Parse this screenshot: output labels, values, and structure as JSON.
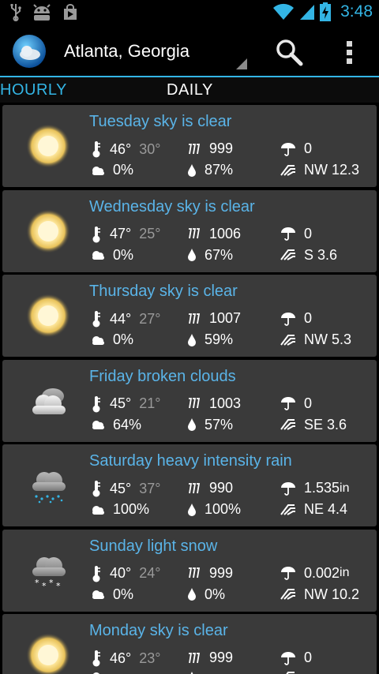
{
  "status_bar": {
    "time": "3:48",
    "icons": [
      "usb-icon",
      "android-debug-icon",
      "play-store-icon",
      "wifi-icon",
      "signal-icon",
      "battery-charging-icon"
    ]
  },
  "action_bar": {
    "location": "Atlanta, Georgia",
    "icons": [
      "app-globe-icon",
      "search-icon",
      "overflow-menu-icon"
    ]
  },
  "tabs": {
    "hourly": "HOURLY",
    "daily": "DAILY",
    "selected": "DAILY"
  },
  "colors": {
    "accent": "#33b5e5",
    "title": "#5ab4e8",
    "card": "#3a3a3a"
  },
  "days": [
    {
      "title": "Tuesday sky is clear",
      "icon": "sun",
      "hi": "46°",
      "lo": "30°",
      "pressure": "999",
      "precip": "0",
      "precip_unit": "",
      "clouds": "0%",
      "humidity": "87%",
      "wind": "NW 12.3"
    },
    {
      "title": "Wednesday sky is clear",
      "icon": "sun",
      "hi": "47°",
      "lo": "25°",
      "pressure": "1006",
      "precip": "0",
      "precip_unit": "",
      "clouds": "0%",
      "humidity": "67%",
      "wind": "S 3.6"
    },
    {
      "title": "Thursday sky is clear",
      "icon": "sun",
      "hi": "44°",
      "lo": "27°",
      "pressure": "1007",
      "precip": "0",
      "precip_unit": "",
      "clouds": "0%",
      "humidity": "59%",
      "wind": "NW 5.3"
    },
    {
      "title": "Friday broken clouds",
      "icon": "clouds",
      "hi": "45°",
      "lo": "21°",
      "pressure": "1003",
      "precip": "0",
      "precip_unit": "",
      "clouds": "64%",
      "humidity": "57%",
      "wind": "SE 3.6"
    },
    {
      "title": "Saturday heavy intensity rain",
      "icon": "rain",
      "hi": "45°",
      "lo": "37°",
      "pressure": "990",
      "precip": "1.535",
      "precip_unit": "in",
      "clouds": "100%",
      "humidity": "100%",
      "wind": "NE 4.4"
    },
    {
      "title": "Sunday light snow",
      "icon": "snow",
      "hi": "40°",
      "lo": "24°",
      "pressure": "999",
      "precip": "0.002",
      "precip_unit": "in",
      "clouds": "0%",
      "humidity": "0%",
      "wind": "NW 10.2"
    },
    {
      "title": "Monday sky is clear",
      "icon": "sun",
      "hi": "46°",
      "lo": "23°",
      "pressure": "999",
      "precip": "0",
      "precip_unit": "",
      "clouds": "",
      "humidity": "",
      "wind": ""
    }
  ]
}
